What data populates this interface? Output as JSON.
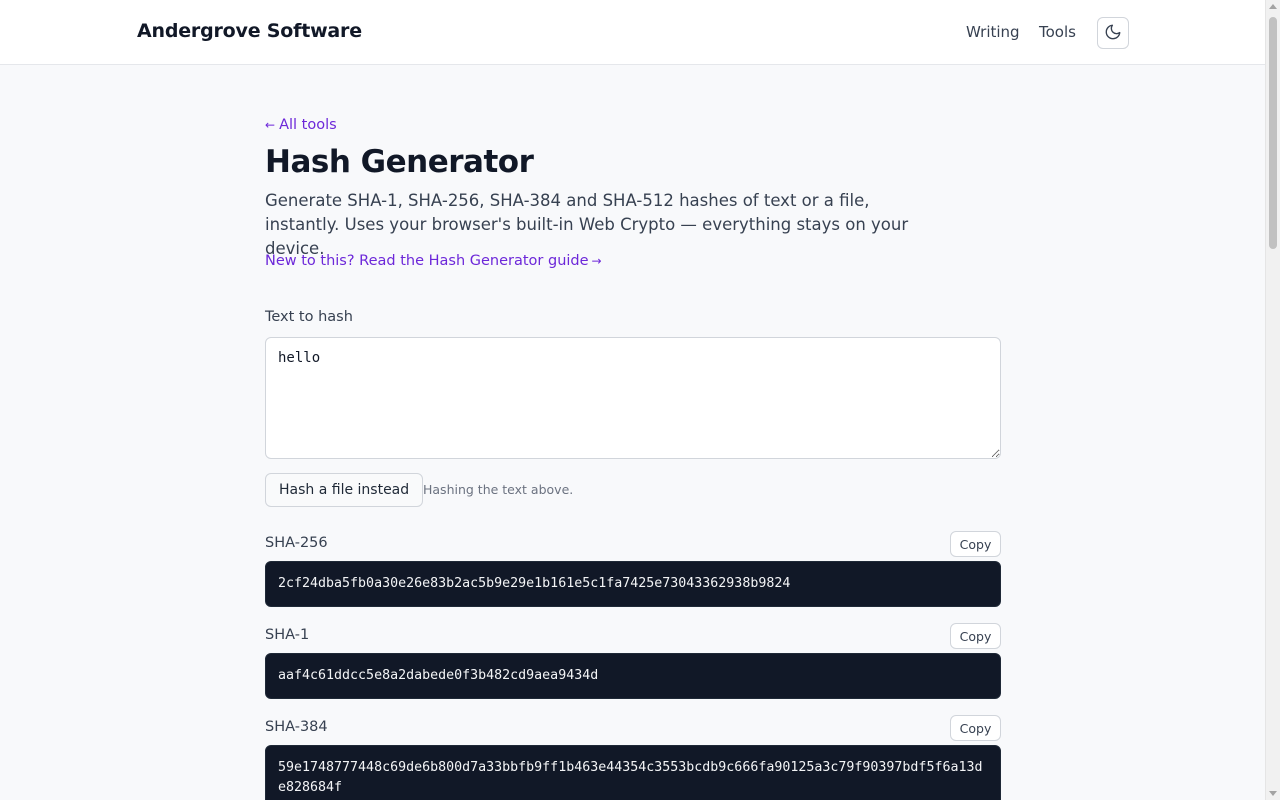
{
  "header": {
    "brand": "Andergrove Software",
    "nav": [
      {
        "label": "Writing"
      },
      {
        "label": "Tools"
      }
    ],
    "theme_toggle_icon": "moon-icon"
  },
  "page": {
    "back_link": {
      "arrow": "←",
      "label": "All tools"
    },
    "title": "Hash Generator",
    "intro": "Generate SHA-1, SHA-256, SHA-384 and SHA-512 hashes of text or a file, instantly. Uses your browser's built-in Web Crypto — everything stays on your device.",
    "guide_link": {
      "label": "New to this? Read the Hash Generator guide",
      "arrow": "→"
    }
  },
  "input": {
    "label": "Text to hash",
    "value": "hello"
  },
  "file_button": {
    "label": "Hash a file instead"
  },
  "status_hint": "Hashing the text above.",
  "hashes": [
    {
      "algorithm": "SHA-256",
      "copy_label": "Copy",
      "value": "2cf24dba5fb0a30e26e83b2ac5b9e29e1b161e5c1fa7425e73043362938b9824"
    },
    {
      "algorithm": "SHA-1",
      "copy_label": "Copy",
      "value": "aaf4c61ddcc5e8a2dabede0f3b482cd9aea9434d"
    },
    {
      "algorithm": "SHA-384",
      "copy_label": "Copy",
      "value": "59e1748777448c69de6b800d7a33bbfb9ff1b463e44354c3553bcdb9c666fa90125a3c79f90397bdf5f6a13de828684f"
    }
  ],
  "colors": {
    "accent": "#6d28d9",
    "hash_background": "#111827",
    "page_background": "#f8f9fb"
  }
}
